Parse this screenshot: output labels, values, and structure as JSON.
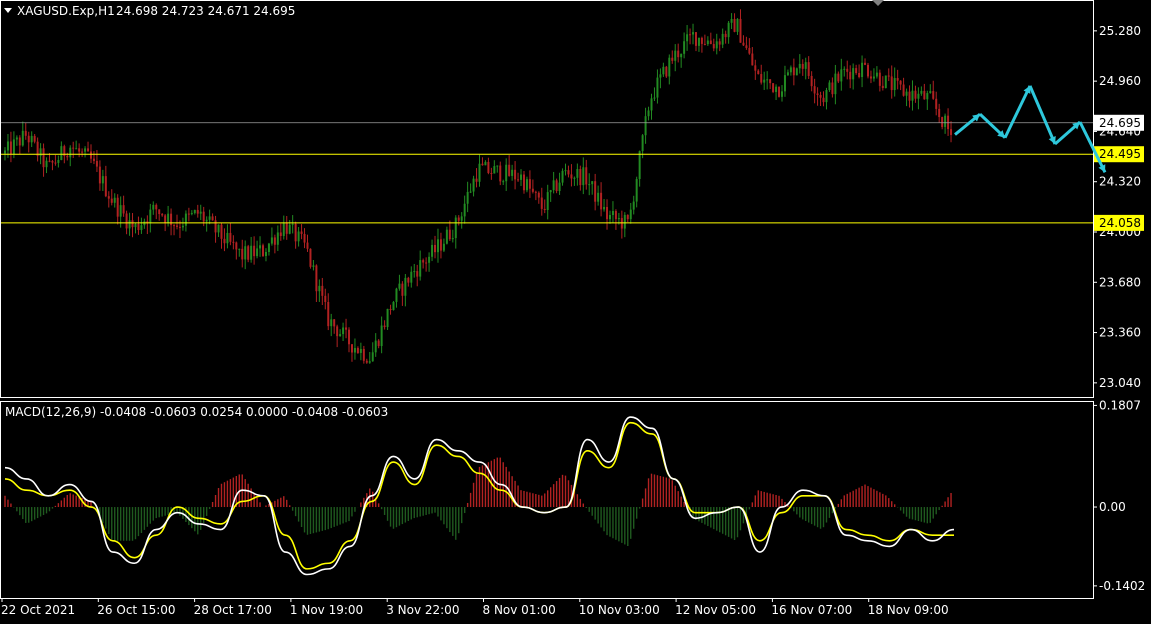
{
  "header": {
    "symbol": "XAGUSD.Exp,H1",
    "ohlc": "24.698 24.723 24.671 24.695"
  },
  "macd_label": "MACD(12,26,9) -0.0408 -0.0603 0.0254 0.0000 -0.0408 -0.0603",
  "colors": {
    "background": "#000000",
    "frame": "#ffffff",
    "bull_candle": "#228b22",
    "bear_candle": "#b22222",
    "level_line": "#ffff00",
    "bid_line": "#a0a0a0",
    "forecast": "#2ec8dc",
    "macd_line": "#ffffff",
    "signal_line": "#ffff00",
    "hist_pos": "#b22222",
    "hist_neg": "#1f5a1f"
  },
  "chart_data": [
    {
      "type": "candlestick",
      "title": "XAGUSD.Exp,H1",
      "price_ticks": [
        "25.280",
        "24.960",
        "24.640",
        "24.320",
        "24.000",
        "23.680",
        "23.360",
        "23.040"
      ],
      "ylim": [
        22.95,
        25.47
      ],
      "current_price": "24.695",
      "levels": [
        "24.495",
        "24.058"
      ],
      "x_ticks": [
        "22 Oct 2021",
        "26 Oct 15:00",
        "28 Oct 17:00",
        "1 Nov 19:00",
        "3 Nov 22:00",
        "8 Nov 01:00",
        "10 Nov 03:00",
        "12 Nov 05:00",
        "16 Nov 07:00",
        "18 Nov 09:00"
      ],
      "price_path": [
        24.5,
        24.62,
        24.4,
        24.55,
        24.45,
        24.2,
        24.02,
        24.15,
        24.05,
        24.12,
        23.98,
        23.85,
        23.88,
        24.05,
        23.9,
        23.45,
        23.3,
        23.2,
        23.55,
        23.75,
        23.88,
        24.05,
        24.4,
        24.38,
        24.35,
        24.15,
        24.38,
        24.35,
        24.1,
        24.05,
        24.85,
        25.1,
        25.25,
        25.2,
        25.33,
        24.98,
        24.92,
        25.1,
        24.85,
        25.02,
        25.05,
        24.95,
        24.88,
        24.85,
        24.62
      ],
      "forecast_path": [
        24.62,
        24.75,
        24.6,
        24.93,
        24.56,
        24.7,
        24.38
      ]
    },
    {
      "type": "macd",
      "title": "MACD(12,26,9)",
      "value_ticks": [
        "0.1807",
        "0.00",
        "-0.1402"
      ],
      "ylim": [
        -0.16,
        0.185
      ],
      "histogram": [
        0.02,
        -0.03,
        -0.01,
        0.025,
        0.01,
        -0.06,
        -0.06,
        -0.02,
        -0.01,
        -0.05,
        0.04,
        0.06,
        0.0,
        0.02,
        -0.05,
        -0.04,
        -0.025,
        0.035,
        -0.04,
        -0.02,
        -0.01,
        -0.06,
        0.07,
        0.09,
        0.03,
        0.02,
        0.06,
        0.0,
        -0.05,
        -0.07,
        0.06,
        0.05,
        -0.02,
        -0.04,
        -0.06,
        0.03,
        0.02,
        -0.02,
        -0.04,
        0.02,
        0.04,
        0.02,
        -0.02,
        -0.03,
        0.025
      ],
      "macd_line": [
        0.07,
        0.05,
        0.02,
        0.04,
        0.01,
        -0.08,
        -0.1,
        -0.04,
        -0.01,
        -0.03,
        -0.04,
        0.03,
        0.02,
        -0.08,
        -0.12,
        -0.11,
        -0.07,
        0.02,
        0.09,
        0.05,
        0.12,
        0.1,
        0.08,
        0.04,
        0.0,
        -0.01,
        0.0,
        0.12,
        0.08,
        0.16,
        0.14,
        0.05,
        -0.02,
        -0.01,
        0.0,
        -0.08,
        0.0,
        0.03,
        0.02,
        -0.05,
        -0.06,
        -0.07,
        -0.04,
        -0.06,
        -0.04
      ],
      "signal_line": [
        0.05,
        0.03,
        0.02,
        0.03,
        0.0,
        -0.06,
        -0.09,
        -0.05,
        0.0,
        -0.02,
        -0.03,
        0.01,
        0.02,
        -0.05,
        -0.11,
        -0.1,
        -0.06,
        0.01,
        0.08,
        0.04,
        0.11,
        0.09,
        0.06,
        0.03,
        0.0,
        -0.01,
        0.0,
        0.1,
        0.07,
        0.15,
        0.13,
        0.05,
        -0.01,
        -0.01,
        0.0,
        -0.06,
        -0.01,
        0.02,
        0.02,
        -0.04,
        -0.05,
        -0.06,
        -0.04,
        -0.05,
        -0.05
      ]
    }
  ]
}
